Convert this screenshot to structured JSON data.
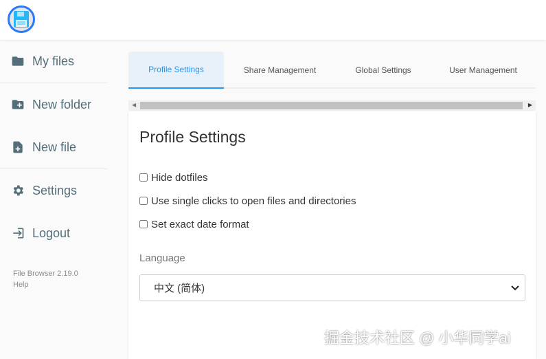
{
  "sidebar": {
    "items": [
      {
        "label": "My files"
      },
      {
        "label": "New folder"
      },
      {
        "label": "New file"
      },
      {
        "label": "Settings"
      },
      {
        "label": "Logout"
      }
    ],
    "version": "File Browser 2.19.0",
    "help": "Help"
  },
  "tabs": [
    {
      "label": "Profile Settings"
    },
    {
      "label": "Share Management"
    },
    {
      "label": "Global Settings"
    },
    {
      "label": "User Management"
    }
  ],
  "profile": {
    "title": "Profile Settings",
    "options": [
      {
        "label": "Hide dotfiles",
        "checked": false
      },
      {
        "label": "Use single clicks to open files and directories",
        "checked": false
      },
      {
        "label": "Set exact date format",
        "checked": false
      }
    ],
    "language_label": "Language",
    "language_value": "中文 (简体)"
  },
  "watermark": "掘金技术社区 @ 小华同学ai"
}
